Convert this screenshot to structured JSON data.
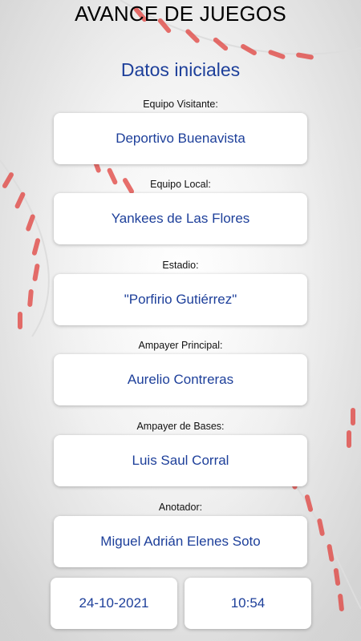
{
  "header": {
    "title": "AVANCE DE JUEGOS"
  },
  "section": {
    "title": "Datos iniciales"
  },
  "fields": [
    {
      "label": "Equipo Visitante:",
      "value": "Deportivo Buenavista"
    },
    {
      "label": "Equipo Local:",
      "value": "Yankees de Las Flores"
    },
    {
      "label": "Estadio:",
      "value": "\"Porfirio Gutiérrez\""
    },
    {
      "label": "Ampayer Principal:",
      "value": "Aurelio Contreras"
    },
    {
      "label": "Ampayer de Bases:",
      "value": "Luis Saul Corral"
    },
    {
      "label": "Anotador:",
      "value": "Miguel Adrián Elenes Soto"
    }
  ],
  "footer": {
    "date": "24-10-2021",
    "time": "10:54"
  },
  "colors": {
    "accent": "#1d3f9a",
    "stitch": "#e0403c"
  }
}
